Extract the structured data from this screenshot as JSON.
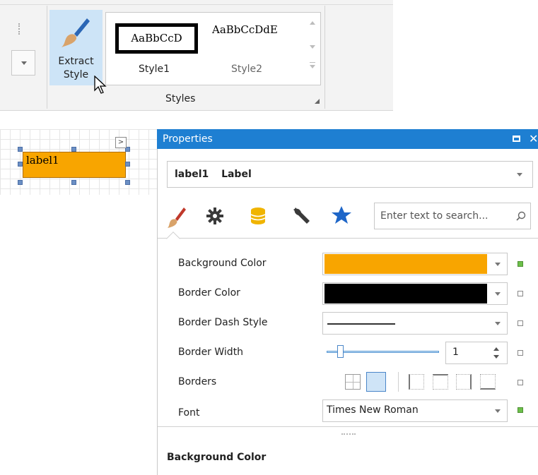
{
  "ribbon": {
    "extract_style_label": "Extract Style",
    "styles_group_label": "Styles",
    "gallery": {
      "style1_preview": "AaBbCcD",
      "style1_name": "Style1",
      "style2_preview": "AaBbCcDdE",
      "style2_name": "Style2"
    }
  },
  "designer": {
    "label_text": "label1",
    "smart_tag": ">"
  },
  "properties": {
    "title": "Properties",
    "object_name": "label1",
    "object_type": "Label",
    "search_placeholder": "Enter text to search...",
    "tabs": [
      {
        "icon": "brush-icon",
        "active": true
      },
      {
        "icon": "gear-icon"
      },
      {
        "icon": "database-icon"
      },
      {
        "icon": "wrench-icon"
      },
      {
        "icon": "star-icon"
      }
    ],
    "rows": [
      {
        "name": "Background Color",
        "color": "#F8A500",
        "modified": true
      },
      {
        "name": "Border Color",
        "color": "#000000",
        "modified": false
      },
      {
        "name": "Border Dash Style",
        "modified": false
      },
      {
        "name": "Border Width",
        "value": "1",
        "modified": false
      },
      {
        "name": "Borders",
        "modified": false
      },
      {
        "name": "Font",
        "value": "Times New Roman",
        "modified": true
      }
    ],
    "description_title": "Background Color"
  },
  "colors": {
    "accent": "#1E7FD2",
    "label_fill": "#F8A500",
    "modified_mark": "#6CC04A"
  }
}
